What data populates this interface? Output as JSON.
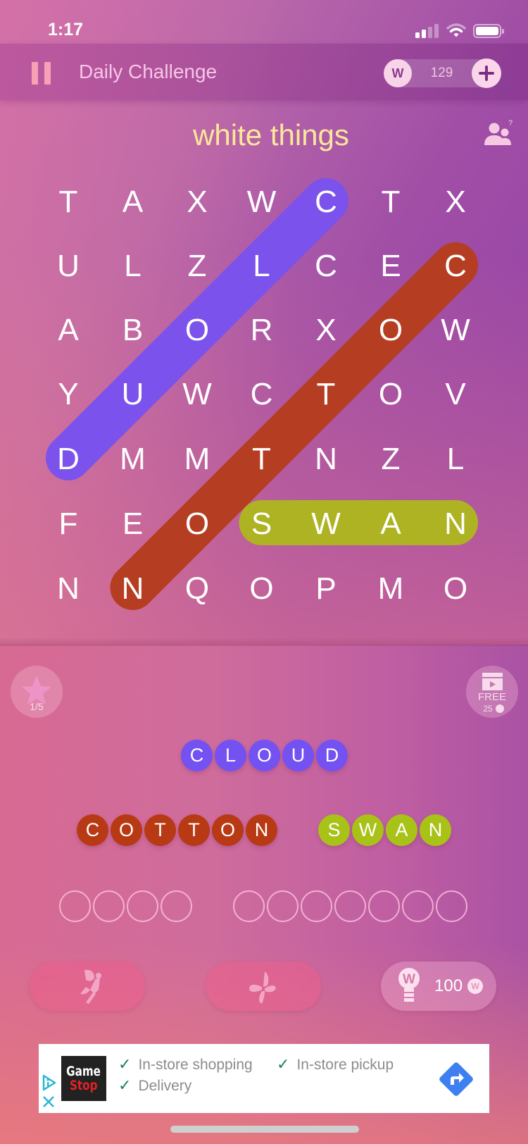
{
  "status_bar": {
    "time": "1:17"
  },
  "header": {
    "title": "Daily Challenge",
    "coins": "129",
    "coin_symbol": "W"
  },
  "puzzle": {
    "category": "white things",
    "grid": [
      [
        "T",
        "A",
        "X",
        "W",
        "C",
        "T",
        "X"
      ],
      [
        "U",
        "L",
        "Z",
        "L",
        "C",
        "E",
        "C"
      ],
      [
        "A",
        "B",
        "O",
        "R",
        "X",
        "O",
        "W"
      ],
      [
        "Y",
        "U",
        "W",
        "C",
        "T",
        "O",
        "V"
      ],
      [
        "D",
        "M",
        "M",
        "T",
        "N",
        "Z",
        "L"
      ],
      [
        "F",
        "E",
        "O",
        "S",
        "W",
        "A",
        "N"
      ],
      [
        "N",
        "N",
        "Q",
        "O",
        "P",
        "M",
        "O"
      ]
    ],
    "found_highlights": [
      {
        "word": "CLOUD",
        "color": "#7b52ec",
        "start": [
          0,
          4
        ],
        "end": [
          4,
          0
        ]
      },
      {
        "word": "COTTON",
        "color": "#b53d22",
        "start": [
          1,
          6
        ],
        "end": [
          6,
          1
        ]
      },
      {
        "word": "SWAN",
        "color": "#adb322",
        "start": [
          5,
          3
        ],
        "end": [
          5,
          6
        ]
      }
    ]
  },
  "side_buttons": {
    "stars": {
      "progress": "1/5"
    },
    "free": {
      "label": "FREE",
      "reward": "25"
    }
  },
  "words": {
    "found": [
      {
        "letters": [
          "C",
          "L",
          "O",
          "U",
          "D"
        ],
        "color": "#7452f2"
      },
      {
        "letters": [
          "C",
          "O",
          "T",
          "T",
          "O",
          "N"
        ],
        "color": "#b83a15"
      },
      {
        "letters": [
          "S",
          "W",
          "A",
          "N"
        ],
        "color": "#a8c218"
      }
    ],
    "remaining_lengths": [
      4,
      7
    ]
  },
  "powerups": {
    "hint_cost": "100",
    "hint_symbol": "W"
  },
  "ad": {
    "brand_line1": "Game",
    "brand_line2": "Stop",
    "features": [
      "In-store shopping",
      "In-store pickup",
      "Delivery"
    ],
    "check_icon": "✓"
  }
}
